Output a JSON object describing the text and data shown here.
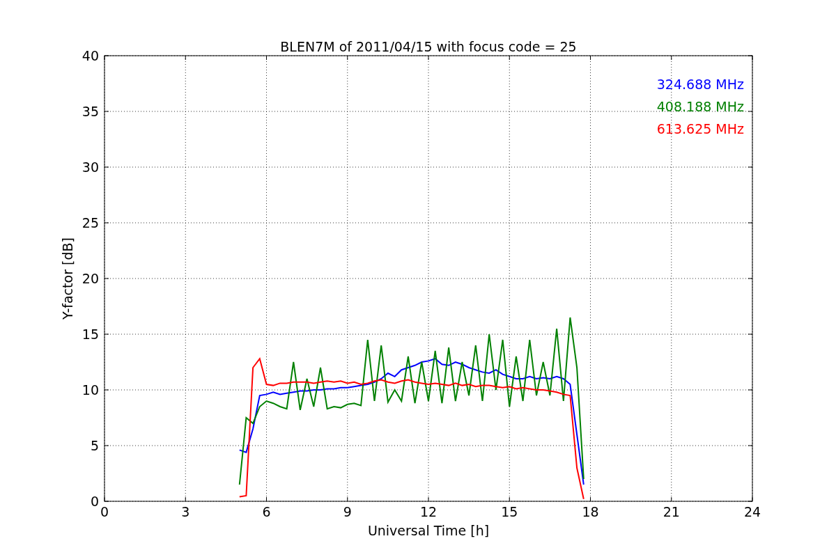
{
  "chart_data": {
    "type": "line",
    "title": "BLEN7M of 2011/04/15 with focus code = 25",
    "xlabel": "Universal Time [h]",
    "ylabel": "Y-factor [dB]",
    "xlim": [
      0,
      24
    ],
    "ylim": [
      0,
      40
    ],
    "grid": true,
    "xticks": [
      0,
      3,
      6,
      9,
      12,
      15,
      18,
      21,
      24
    ],
    "yticks": [
      0,
      5,
      10,
      15,
      20,
      25,
      30,
      35,
      40
    ],
    "x": [
      5,
      5.25,
      5.5,
      5.75,
      6,
      6.25,
      6.5,
      6.75,
      7,
      7.25,
      7.5,
      7.75,
      8,
      8.25,
      8.5,
      8.75,
      9,
      9.25,
      9.5,
      9.75,
      10,
      10.25,
      10.5,
      10.75,
      11,
      11.25,
      11.5,
      11.75,
      12,
      12.25,
      12.5,
      12.75,
      13,
      13.25,
      13.5,
      13.75,
      14,
      14.25,
      14.5,
      14.75,
      15,
      15.25,
      15.5,
      15.75,
      16,
      16.25,
      16.5,
      16.75,
      17,
      17.25,
      17.5,
      17.75
    ],
    "series": [
      {
        "name": "324.688 MHz",
        "color": "#0000ff",
        "values": [
          4.6,
          4.4,
          6.5,
          9.5,
          9.6,
          9.8,
          9.6,
          9.7,
          9.8,
          9.9,
          9.9,
          10.0,
          10.0,
          10.1,
          10.1,
          10.2,
          10.2,
          10.3,
          10.4,
          10.5,
          10.7,
          11.0,
          11.5,
          11.2,
          11.8,
          12.0,
          12.2,
          12.5,
          12.6,
          12.8,
          12.3,
          12.2,
          12.5,
          12.3,
          12.0,
          11.8,
          11.6,
          11.5,
          11.8,
          11.4,
          11.2,
          11.0,
          11.0,
          11.2,
          11.0,
          11.1,
          11.0,
          11.2,
          11.0,
          10.5,
          6.0,
          1.5
        ]
      },
      {
        "name": "408.188 MHz",
        "color": "#008000",
        "values": [
          1.5,
          7.5,
          7.0,
          8.5,
          9.0,
          8.8,
          8.5,
          8.3,
          12.5,
          8.2,
          11,
          8.5,
          12,
          8.3,
          8.5,
          8.4,
          8.7,
          8.8,
          8.6,
          14.5,
          9,
          14,
          8.9,
          10,
          9,
          13,
          8.8,
          12.5,
          9,
          13.5,
          8.8,
          13.8,
          9,
          12.5,
          9.5,
          14,
          9,
          15,
          10,
          14.5,
          8.5,
          13,
          9,
          14.5,
          9.5,
          12.5,
          9.5,
          15.5,
          9,
          16.5,
          12,
          2
        ]
      },
      {
        "name": "613.625 MHz",
        "color": "#ff0000",
        "values": [
          0.4,
          0.5,
          12,
          12.8,
          10.5,
          10.4,
          10.6,
          10.6,
          10.7,
          10.7,
          10.7,
          10.6,
          10.7,
          10.8,
          10.7,
          10.8,
          10.6,
          10.7,
          10.5,
          10.6,
          10.8,
          10.9,
          10.7,
          10.6,
          10.8,
          10.9,
          10.7,
          10.6,
          10.5,
          10.6,
          10.5,
          10.4,
          10.6,
          10.4,
          10.5,
          10.3,
          10.4,
          10.4,
          10.3,
          10.2,
          10.3,
          10.1,
          10.2,
          10.1,
          10.0,
          10.0,
          9.9,
          9.8,
          9.6,
          9.5,
          3.0,
          0.2
        ]
      }
    ]
  }
}
